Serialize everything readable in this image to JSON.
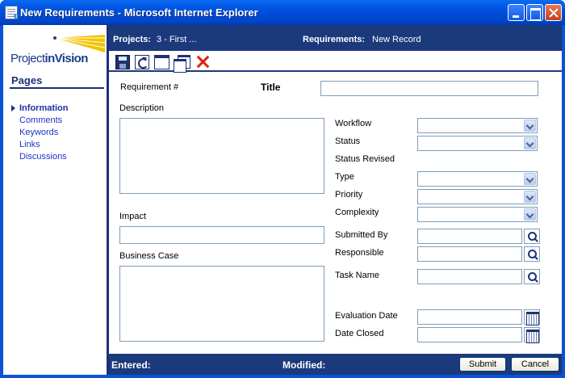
{
  "window": {
    "title": "New Requirements - Microsoft Internet Explorer"
  },
  "logo": {
    "part1": "Project",
    "part2": "inVision"
  },
  "nav": {
    "heading": "Pages",
    "items": [
      {
        "label": "Information",
        "active": true
      },
      {
        "label": "Comments"
      },
      {
        "label": "Keywords"
      },
      {
        "label": "Links"
      },
      {
        "label": "Discussions"
      }
    ]
  },
  "header": {
    "projects_label": "Projects:",
    "projects_value": "3 - First ...",
    "requirements_label": "Requirements:",
    "requirements_value": "New Record"
  },
  "toolbar": {
    "icons": [
      "save-icon",
      "refresh-icon",
      "new-window-icon",
      "multiple-windows-icon",
      "delete-icon"
    ]
  },
  "form": {
    "requirement_number_label": "Requirement #",
    "title_label": "Title",
    "title_value": "",
    "description_label": "Description",
    "description_value": "",
    "impact_label": "Impact",
    "impact_value": "",
    "business_case_label": "Business Case",
    "business_case_value": "",
    "workflow_label": "Workflow",
    "status_label": "Status",
    "status_revised_label": "Status Revised",
    "type_label": "Type",
    "priority_label": "Priority",
    "complexity_label": "Complexity",
    "submitted_by_label": "Submitted By",
    "responsible_label": "Responsible",
    "task_name_label": "Task Name",
    "evaluation_date_label": "Evaluation Date",
    "date_closed_label": "Date Closed"
  },
  "footer": {
    "entered_label": "Entered:",
    "modified_label": "Modified:",
    "submit_label": "Submit",
    "cancel_label": "Cancel"
  },
  "colors": {
    "titlebar": "#0054e3",
    "header_bar": "#1b3a7c",
    "nav_link": "#1f32c8",
    "logo_fan": "#f2c400"
  }
}
